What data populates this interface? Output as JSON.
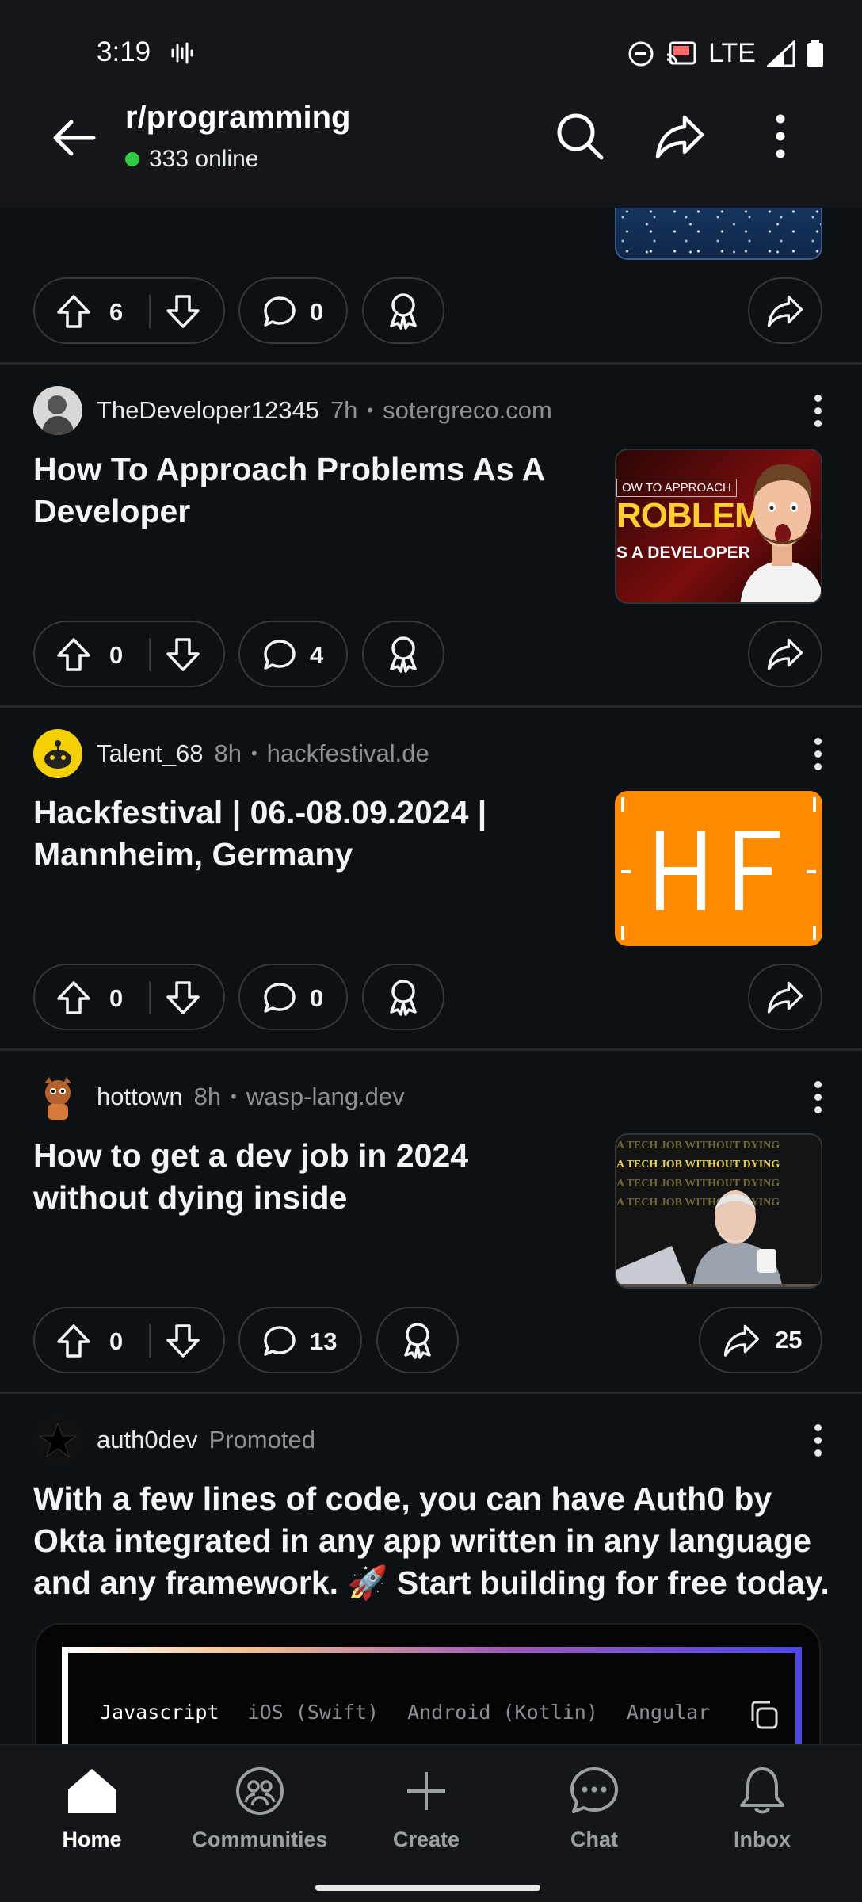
{
  "status_bar": {
    "time": "3:19",
    "network": "LTE"
  },
  "header": {
    "title": "r/programming",
    "online": "333 online"
  },
  "top_post_actions": {
    "upvotes": "6",
    "comments": "0"
  },
  "posts": [
    {
      "user": "TheDeveloper12345",
      "time": "7h",
      "domain": "sotergreco.com",
      "title": "How To Approach Problems As A Developer",
      "upvotes": "0",
      "comments": "4",
      "thumb": {
        "line1": "OW TO APPROACH",
        "line2": "ROBLEMS",
        "line3": "S A DEVELOPER"
      }
    },
    {
      "user": "Talent_68",
      "time": "8h",
      "domain": "hackfestival.de",
      "title": "Hackfestival | 06.-08.09.2024 | Mannheim, Germany",
      "upvotes": "0",
      "comments": "0"
    },
    {
      "user": "hottown",
      "time": "8h",
      "domain": "wasp-lang.dev",
      "title": "How to get a dev job in 2024 without dying inside",
      "upvotes": "0",
      "comments": "13",
      "shares": "25",
      "thumb": {
        "line1": "A TECH JOB WITHOUT DYING",
        "line2": "A TECH JOB WITHOUT DYING",
        "line3": "A TECH JOB WITHOUT DYING",
        "line4": "A TECH JOB WITHOUT DYING"
      }
    }
  ],
  "promoted": {
    "user": "auth0dev",
    "label": "Promoted",
    "title": "With a few lines of code, you can have Auth0 by Okta integrated in any app written in any language and any framework. 🚀 Start building for free today.",
    "tabs": [
      "Javascript",
      "iOS (Swift)",
      "Android (Kotlin)",
      "Angular"
    ]
  },
  "bottom_nav": {
    "home": "Home",
    "communities": "Communities",
    "create": "Create",
    "chat": "Chat",
    "inbox": "Inbox"
  },
  "colors": {
    "background": "#0e1113",
    "online_dot": "#2ecc40",
    "hf_orange": "#ff8c00"
  }
}
